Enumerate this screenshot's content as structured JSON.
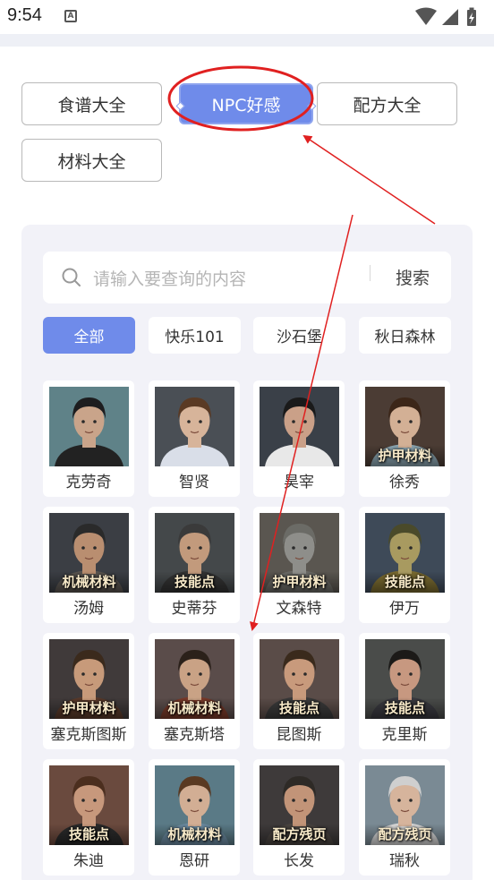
{
  "status_bar": {
    "time": "9:54",
    "notification_icon": "A"
  },
  "tabs": [
    {
      "label": "食谱大全",
      "active": false
    },
    {
      "label": "NPC好感",
      "active": true
    },
    {
      "label": "配方大全",
      "active": false
    },
    {
      "label": "材料大全",
      "active": false
    }
  ],
  "search": {
    "placeholder": "请输入要查询的内容",
    "button_label": "搜索"
  },
  "filters": [
    {
      "label": "全部",
      "active": true
    },
    {
      "label": "快乐101",
      "active": false
    },
    {
      "label": "沙石堡",
      "active": false
    },
    {
      "label": "秋日森林",
      "active": false
    }
  ],
  "npcs": [
    {
      "name": "克劳奇",
      "badge": ""
    },
    {
      "name": "智贤",
      "badge": ""
    },
    {
      "name": "昊宰",
      "badge": ""
    },
    {
      "name": "徐秀",
      "badge": "护甲材料"
    },
    {
      "name": "汤姆",
      "badge": "机械材料"
    },
    {
      "name": "史蒂芬",
      "badge": "技能点"
    },
    {
      "name": "文森特",
      "badge": "护甲材料"
    },
    {
      "name": "伊万",
      "badge": "技能点"
    },
    {
      "name": "塞克斯图斯",
      "badge": "护甲材料"
    },
    {
      "name": "塞克斯塔",
      "badge": "机械材料"
    },
    {
      "name": "昆图斯",
      "badge": "技能点"
    },
    {
      "name": "克里斯",
      "badge": "技能点"
    },
    {
      "name": "朱迪",
      "badge": "技能点"
    },
    {
      "name": "恩研",
      "badge": "机械材料"
    },
    {
      "name": "长发",
      "badge": "配方残页"
    },
    {
      "name": "瑞秋",
      "badge": "配方残页"
    }
  ],
  "colors": {
    "accent": "#6f8bea",
    "panel_bg": "#f2f2f8",
    "annotation_red": "#e02020"
  }
}
